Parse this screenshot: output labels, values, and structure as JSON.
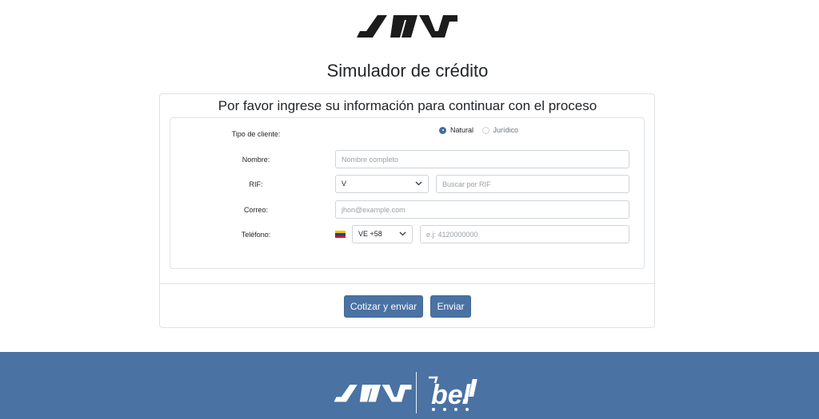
{
  "header": {
    "logo_icon": "brand-logo-icon",
    "title": "Simulador de crédito"
  },
  "form": {
    "subtitle": "Por favor ingrese su información para continuar con el proceso",
    "client_type": {
      "label": "Tipo de cliente:",
      "options": [
        {
          "label": "Natural",
          "checked": true
        },
        {
          "label": "Jurídico",
          "checked": false
        }
      ]
    },
    "name": {
      "label": "Nombre:",
      "placeholder": "Nombre completo",
      "value": ""
    },
    "rif": {
      "label": "RIF:",
      "selected": "V",
      "search_placeholder": "Buscar por RIF"
    },
    "email": {
      "label": "Correo:",
      "placeholder": "jhon@example.com"
    },
    "phone": {
      "label": "Teléfono:",
      "country_flag": "venezuela-flag-icon",
      "country_code": "VE +58",
      "placeholder": "e.j: 4120000000"
    }
  },
  "actions": {
    "quote_send": "Cotizar y enviar",
    "send": "Enviar"
  },
  "footer": {
    "logo_icon": "brand-logo-icon",
    "partner_logo_text": "bel"
  },
  "colors": {
    "accent": "#4a72a3",
    "border": "#dee2e6",
    "text": "#212529"
  }
}
